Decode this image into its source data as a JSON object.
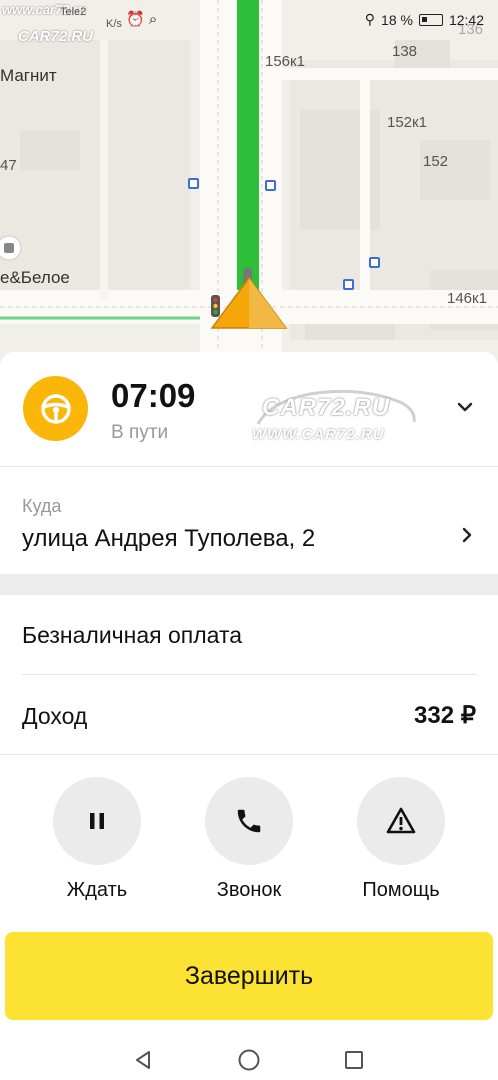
{
  "status_bar": {
    "carrier": "Tele2",
    "speed": "K/s",
    "battery_percent": "18 %",
    "time": "12:42"
  },
  "watermark": {
    "url": "www.car72.ru",
    "brand": "CAR72.RU",
    "url_upper": "WWW.CAR72.RU"
  },
  "map": {
    "labels": [
      "Магнит",
      "156к1",
      "138",
      "152к1",
      "152",
      "146к1",
      "136",
      "47",
      "е&Белое"
    ],
    "route_color": "#2ebf3a",
    "arrow_color": "#f5a70a"
  },
  "order": {
    "eta": "07:09",
    "status": "В пути",
    "badge_color": "#fbb60a"
  },
  "destination": {
    "label": "Куда",
    "address": "улица Андрея Туполева, 2"
  },
  "payment": {
    "method": "Безналичная оплата",
    "income_label": "Доход",
    "income_value": "332 ₽"
  },
  "actions": [
    {
      "label": "Ждать",
      "icon": "pause-icon"
    },
    {
      "label": "Звонок",
      "icon": "phone-icon"
    },
    {
      "label": "Помощь",
      "icon": "warning-icon"
    }
  ],
  "finish_button": {
    "label": "Завершить",
    "color": "#fce232"
  }
}
